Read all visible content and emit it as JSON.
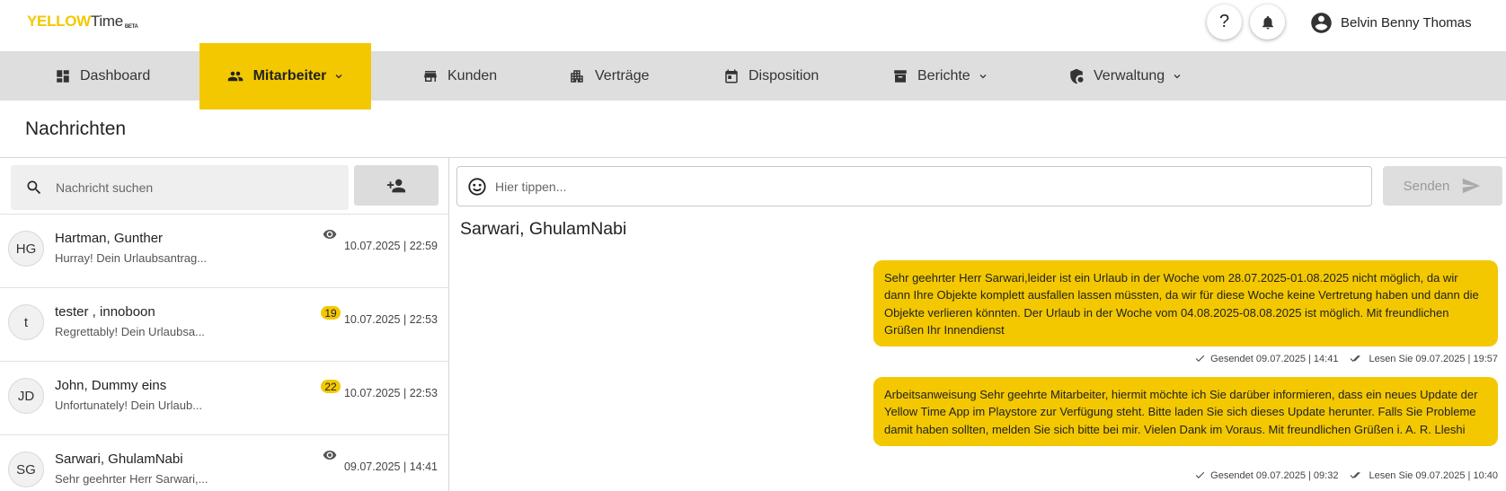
{
  "brand": {
    "logo_yellow": "YELLOW",
    "logo_time": "Time",
    "logo_beta": "BETA"
  },
  "header": {
    "help_label": "?",
    "user_name": "Belvin Benny Thomas"
  },
  "nav": {
    "dashboard": "Dashboard",
    "mitarbeiter": "Mitarbeiter",
    "kunden": "Kunden",
    "vertraege": "Verträge",
    "disposition": "Disposition",
    "berichte": "Berichte",
    "verwaltung": "Verwaltung"
  },
  "page": {
    "title": "Nachrichten"
  },
  "search": {
    "placeholder": "Nachricht suchen"
  },
  "conversations": [
    {
      "initials": "HG",
      "name": "Hartman, Gunther",
      "preview": "Hurray! Dein Urlaubsantrag...",
      "time": "10.07.2025 | 22:59",
      "badge": ""
    },
    {
      "initials": "t",
      "name": "tester , innoboon",
      "preview": "Regrettably! Dein Urlaubsa...",
      "time": "10.07.2025 | 22:53",
      "badge": "19"
    },
    {
      "initials": "JD",
      "name": "John, Dummy eins",
      "preview": "Unfortunately! Dein Urlaub...",
      "time": "10.07.2025 | 22:53",
      "badge": "22"
    },
    {
      "initials": "SG",
      "name": "Sarwari, GhulamNabi",
      "preview": "Sehr geehrter Herr Sarwari,...",
      "time": "09.07.2025 | 14:41",
      "badge": ""
    }
  ],
  "composer": {
    "placeholder": "Hier tippen...",
    "send_label": "Senden"
  },
  "chat": {
    "title": "Sarwari, GhulamNabi",
    "messages": [
      {
        "text": "Sehr geehrter Herr Sarwari,leider ist ein Urlaub in der Woche vom 28.07.2025-01.08.2025 nicht möglich, da wir dann Ihre Objekte komplett ausfallen lassen müssten, da wir für diese Woche keine Vertretung haben und dann die Objekte verlieren könnten. Der Urlaub in der Woche vom 04.08.2025-08.08.2025 ist möglich. Mit freundlichen Grüßen Ihr Innendienst",
        "sent": "Gesendet 09.07.2025 | 14:41",
        "read": "Lesen Sie 09.07.2025 | 19:57"
      },
      {
        "text": "Arbeitsanweisung Sehr geehrte Mitarbeiter, hiermit möchte ich Sie darüber informieren, dass ein neues Update der Yellow Time App im Playstore zur Verfügung steht. Bitte laden Sie sich dieses Update herunter. Falls Sie Probleme damit haben sollten, melden Sie sich bitte bei mir. Vielen Dank im Voraus. Mit freundlichen Grüßen i. A. R. Lleshi",
        "sent": "Gesendet 09.07.2025 | 09:32",
        "read": "Lesen Sie 09.07.2025 | 10:40"
      }
    ]
  },
  "colors": {
    "accent": "#f3c800",
    "nav_bg": "#dedede"
  },
  "icons": {
    "help": "help-icon",
    "bell": "bell-icon",
    "account": "account-circle-icon",
    "eye": "eye-icon",
    "send": "send-icon"
  }
}
